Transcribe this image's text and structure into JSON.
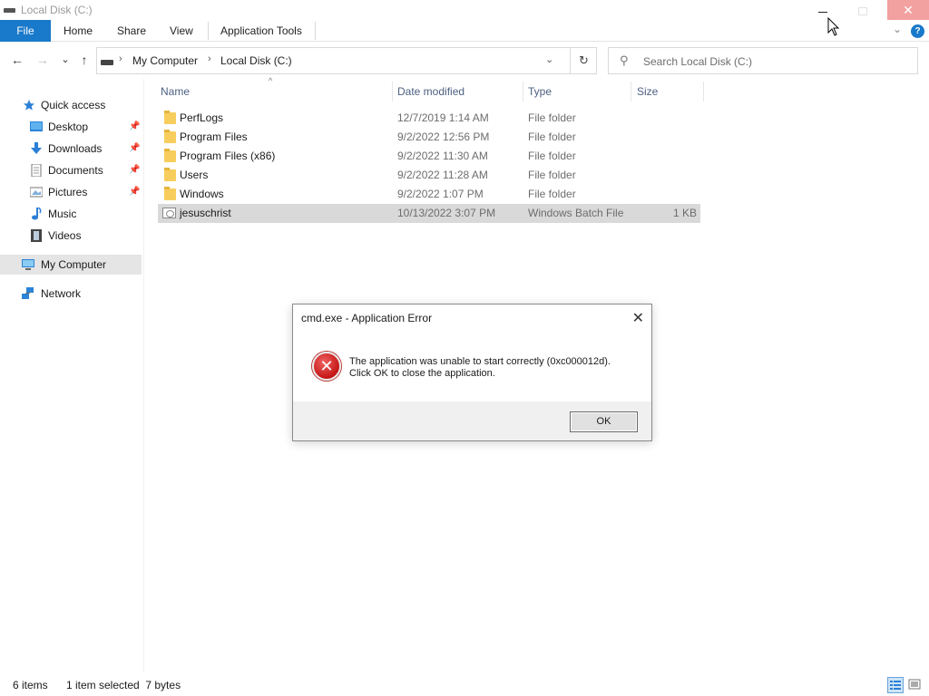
{
  "window": {
    "title": "Local Disk (C:)",
    "close_symbol": "✕"
  },
  "ribbon": {
    "tabs": [
      "File",
      "Home",
      "Share",
      "View",
      "Application Tools"
    ],
    "collapse_symbol": "⌄",
    "help_symbol": "?",
    "accent_color": "#1979ca"
  },
  "address": {
    "back_symbol": "←",
    "forward_symbol": "→",
    "recent_symbol": "⌄",
    "up_symbol": "↑",
    "crumbs": [
      "My Computer",
      "Local Disk (C:)"
    ],
    "crumb_separator": "›",
    "dropdown_symbol": "⌄",
    "refresh_symbol": "↻"
  },
  "search": {
    "icon": "⚲",
    "placeholder": "Search Local Disk (C:)"
  },
  "nav": {
    "quick_access": "Quick access",
    "pinned": [
      {
        "label": "Desktop",
        "icon": "desktop-icon"
      },
      {
        "label": "Downloads",
        "icon": "downloads-icon"
      },
      {
        "label": "Documents",
        "icon": "documents-icon"
      },
      {
        "label": "Pictures",
        "icon": "pictures-icon"
      }
    ],
    "unpinned": [
      {
        "label": "Music",
        "icon": "music-icon"
      },
      {
        "label": "Videos",
        "icon": "videos-icon"
      }
    ],
    "pin_symbol": "📌",
    "this_pc": "My Computer",
    "network": "Network"
  },
  "columns": {
    "name": "Name",
    "date": "Date modified",
    "type": "Type",
    "size": "Size",
    "sort_symbol": "^"
  },
  "files": [
    {
      "name": "PerfLogs",
      "date": "12/7/2019 1:14 AM",
      "type": "File folder",
      "size": "",
      "kind": "folder"
    },
    {
      "name": "Program Files",
      "date": "9/2/2022 12:56 PM",
      "type": "File folder",
      "size": "",
      "kind": "folder"
    },
    {
      "name": "Program Files (x86)",
      "date": "9/2/2022 11:30 AM",
      "type": "File folder",
      "size": "",
      "kind": "folder"
    },
    {
      "name": "Users",
      "date": "9/2/2022 11:28 AM",
      "type": "File folder",
      "size": "",
      "kind": "folder"
    },
    {
      "name": "Windows",
      "date": "9/2/2022 1:07 PM",
      "type": "File folder",
      "size": "",
      "kind": "folder"
    },
    {
      "name": "jesuschrist",
      "date": "10/13/2022 3:07 PM",
      "type": "Windows Batch File",
      "size": "1 KB",
      "kind": "batch",
      "selected": true
    }
  ],
  "status": {
    "item_count": "6 items",
    "selection": "1 item selected  7 bytes"
  },
  "dialog": {
    "title": "cmd.exe - Application Error",
    "close_symbol": "✕",
    "error_symbol": "✕",
    "message_line1": "The application was unable to start correctly (0xc000012d).",
    "message_line2": "Click OK to close the application.",
    "ok_label": "OK"
  }
}
